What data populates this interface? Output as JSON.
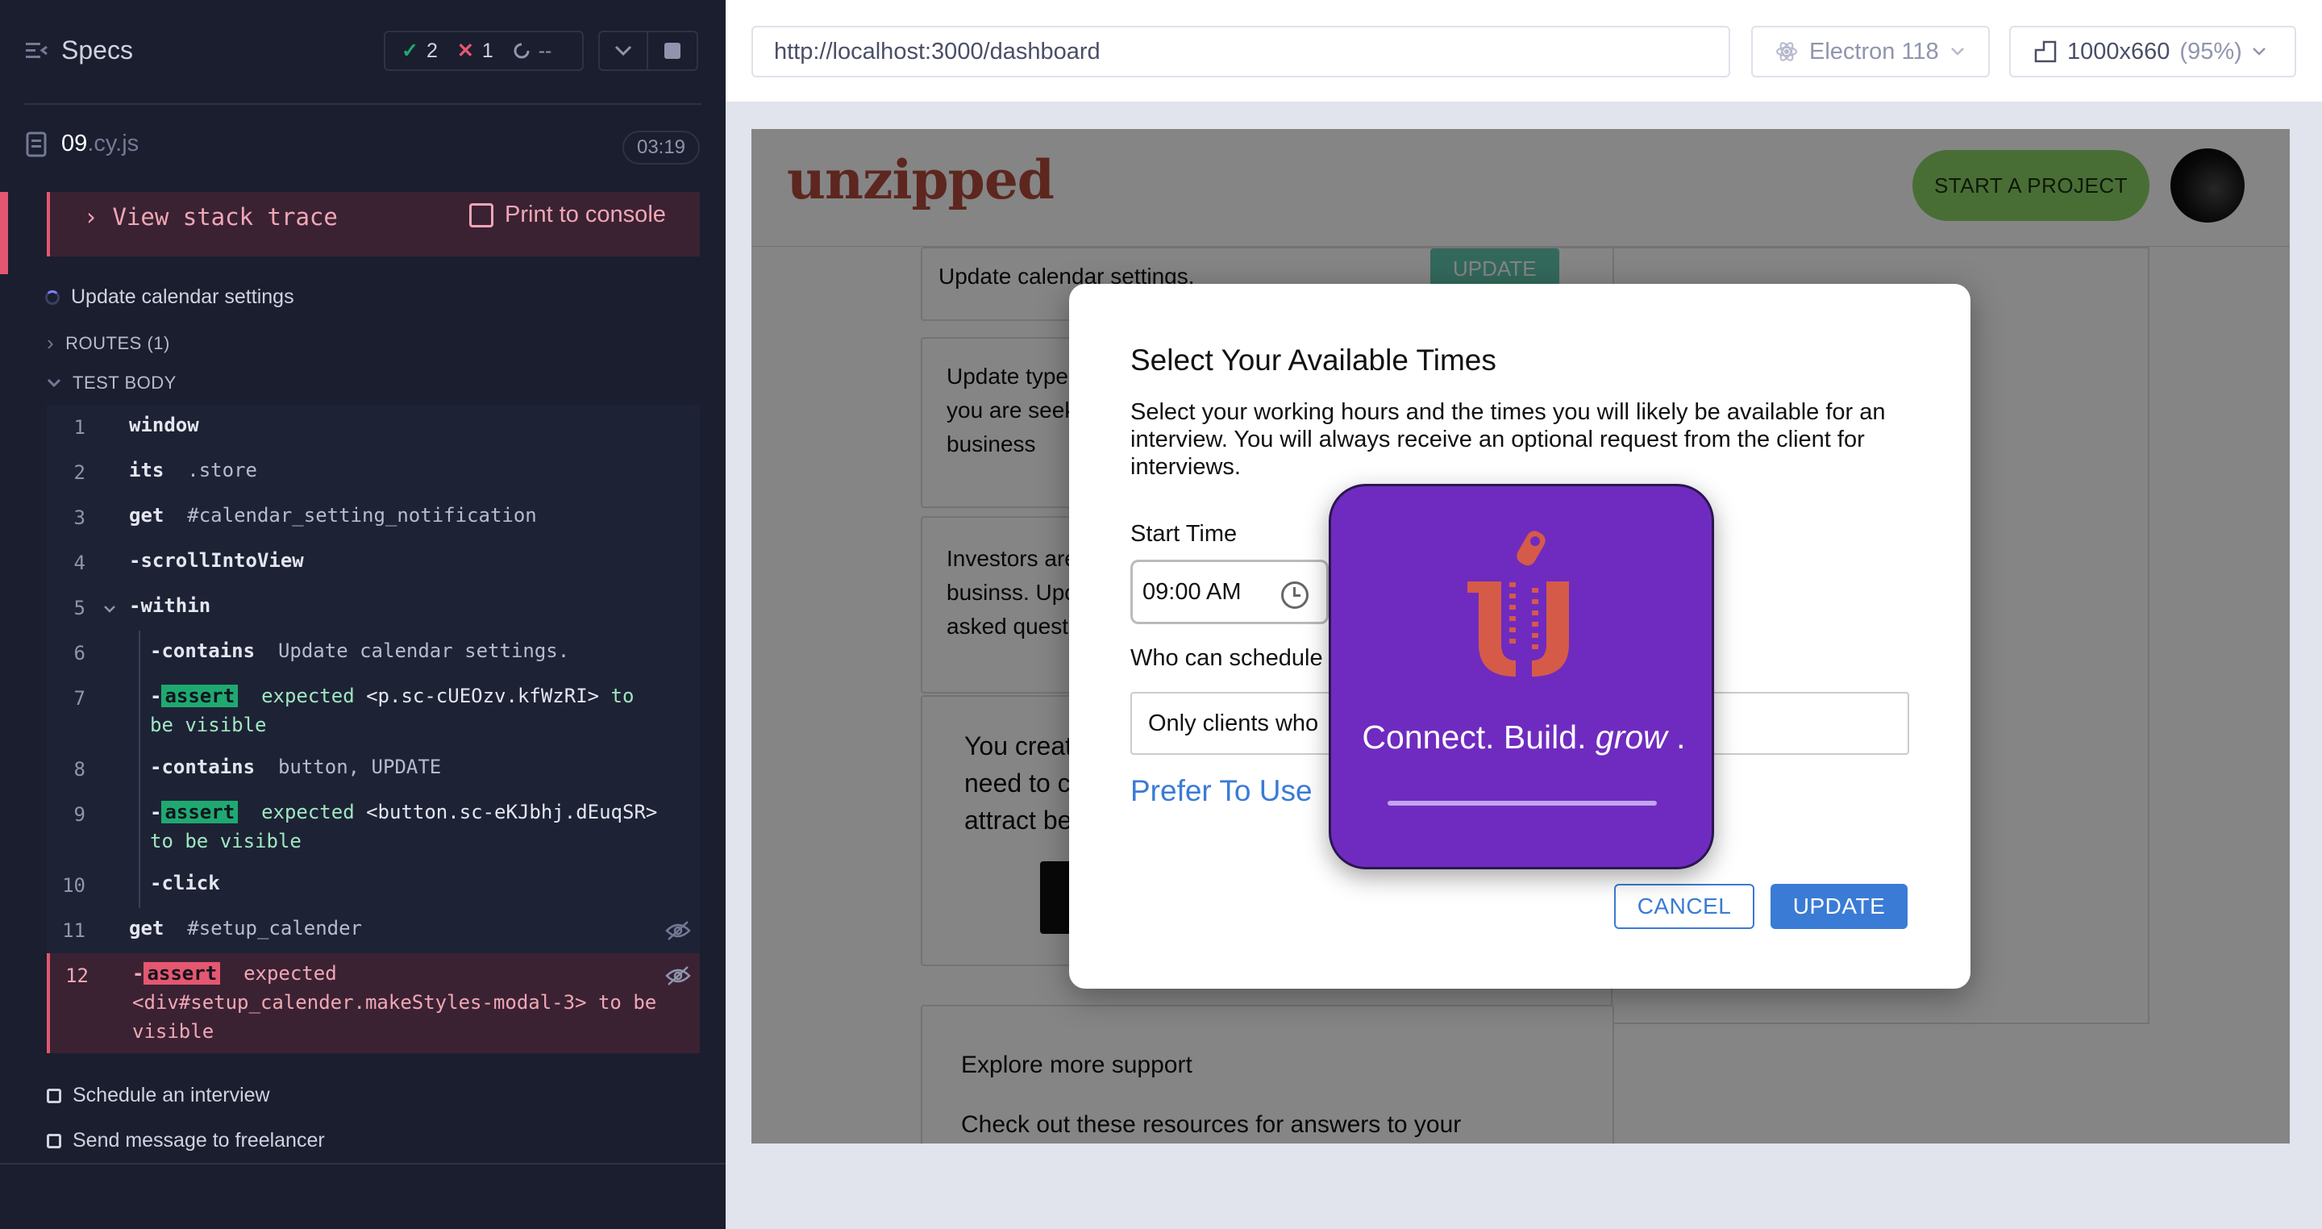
{
  "reporter": {
    "title": "Specs",
    "stats": {
      "passed": "2",
      "failed": "1",
      "pending": "--"
    },
    "file": {
      "name": "09",
      "ext": ".cy.js",
      "duration": "03:19"
    },
    "error": {
      "stack_trace_label": "View stack trace",
      "print_label": "Print to console"
    },
    "current_test": "Update calendar settings",
    "routes_label": "ROUTES (1)",
    "test_body_label": "TEST BODY",
    "commands": [
      {
        "num": "1",
        "cmd": "window",
        "arg": ""
      },
      {
        "num": "2",
        "cmd": "its",
        "arg": ".store"
      },
      {
        "num": "3",
        "cmd": "get",
        "arg": "#calendar_setting_notification"
      },
      {
        "num": "4",
        "cmd": "-scrollIntoView",
        "arg": ""
      },
      {
        "num": "5",
        "cmd": "-within",
        "arg": ""
      },
      {
        "num": "6",
        "cmd": "-contains",
        "arg": "Update calendar settings."
      },
      {
        "num": "7",
        "cmd": "-",
        "badge": "assert",
        "msg1": "expected",
        "arg": "<p.sc-cUEOzv.kfWzRI>",
        "msg2": "to be",
        "msg3": "visible"
      },
      {
        "num": "8",
        "cmd": "-contains",
        "arg": "button, UPDATE"
      },
      {
        "num": "9",
        "cmd": "-",
        "badge": "assert",
        "msg1": "expected",
        "arg": "<button.sc-eKJbhj.dEuqSR>",
        "msg2": "to be",
        "msg3": "visible"
      },
      {
        "num": "10",
        "cmd": "-click",
        "arg": ""
      },
      {
        "num": "11",
        "cmd": "get",
        "arg": "#setup_calender"
      },
      {
        "num": "12",
        "cmd": "-",
        "badge": "assert",
        "msg1": "expected",
        "arg": "<div#setup_calender.makeStyles-modal-3>",
        "msg2": "to",
        "msg3": "be",
        "msg4": "visible"
      }
    ],
    "other_tests": [
      "Schedule an interview",
      "Send message to freelancer"
    ]
  },
  "aut_bar": {
    "url": "http://localhost:3000/dashboard",
    "browser": "Electron 118",
    "viewport": "1000x660",
    "zoom": "(95%)"
  },
  "app": {
    "logo": "unzipped",
    "start_project": "START A PROJECT",
    "bg_cards": {
      "calendar_text": "Update calendar settings.",
      "update_btn": "UPDATE",
      "type_text": [
        "Update type",
        "you are seek",
        "business"
      ],
      "investors_text": [
        "Investors are",
        "businss. Upc",
        "asked quest"
      ],
      "created_text": [
        "You creat",
        "need to c",
        "attract be"
      ],
      "support_title": "Explore more support",
      "support_text": "Check out these resources for answers to your"
    }
  },
  "modal": {
    "title": "Select Your Available Times",
    "description": "Select your working hours and the times you will likely be available for an interview. You will always receive an optional request from the client for interviews.",
    "start_time_label": "Start Time",
    "start_time_value": "09:00 AM",
    "who_label": "Who can schedule",
    "who_value": "Only clients who",
    "prefer_link": "Prefer To Use",
    "cancel": "CANCEL",
    "update": "UPDATE"
  },
  "splash": {
    "tagline_a": "Connect. Build.",
    "tagline_b": "grow",
    "tagline_c": ".",
    "progress": 1.0
  },
  "colors": {
    "reporter_bg": "#1b1e2e",
    "pass": "#1fa971",
    "fail": "#e45770",
    "brand_logo": "#b34a3c",
    "start_btn": "#8bd467",
    "splash_bg": "#6f2bbf",
    "link_blue": "#3a7bd5"
  }
}
